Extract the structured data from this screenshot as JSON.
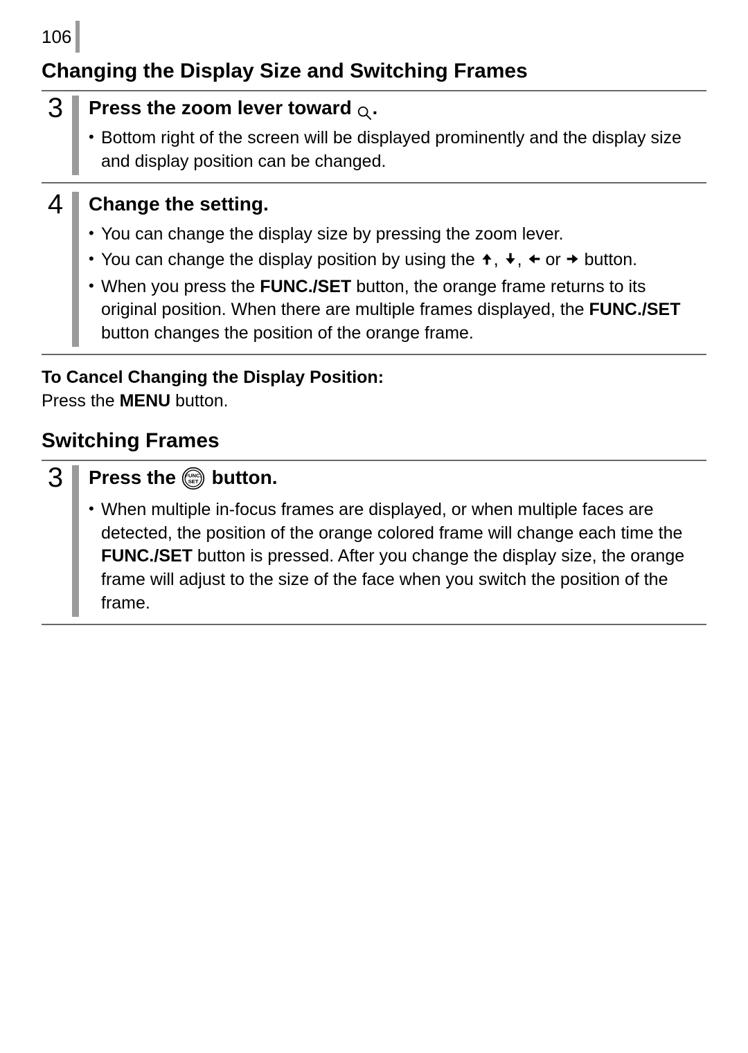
{
  "page_number": "106",
  "section1_title": "Changing the Display Size and Switching Frames",
  "step3": {
    "num": "3",
    "title_pre": "Press the zoom lever toward ",
    "title_post": ".",
    "bullets": [
      "Bottom right of the screen will be displayed prominently and the display size and display position can be changed."
    ]
  },
  "step4": {
    "num": "4",
    "title": "Change the setting.",
    "bullet1": "You can change the display size by pressing the zoom lever.",
    "bullet2_pre": "You can change the display position by using the ",
    "bullet2_sep1": ", ",
    "bullet2_sep2": ", ",
    "bullet2_or": " or ",
    "bullet2_post": " button.",
    "bullet3_seg1": "When you press the ",
    "bullet3_seg2_bold": "FUNC./SET",
    "bullet3_seg3": " button, the orange frame returns to its original position. When there are multiple frames displayed, the ",
    "bullet3_seg4_bold": "FUNC./SET",
    "bullet3_seg5": " button changes the position of the orange frame."
  },
  "cancel_note": {
    "line1_bold": "To Cancel Changing the Display Position:",
    "line2_pre": "Press the ",
    "line2_bold": "MENU",
    "line2_post": " button."
  },
  "section2_title": "Switching Frames",
  "step3b": {
    "num": "3",
    "title_pre": "Press the ",
    "title_post": " button.",
    "bullet_seg1": "When multiple in-focus frames are displayed, or when multiple faces are detected, the position of the orange colored frame will change each time the ",
    "bullet_seg2_bold": "FUNC./SET",
    "bullet_seg3": " button is pressed. After you change the display size, the orange frame will adjust to the size of the face when you switch the position of the frame."
  }
}
